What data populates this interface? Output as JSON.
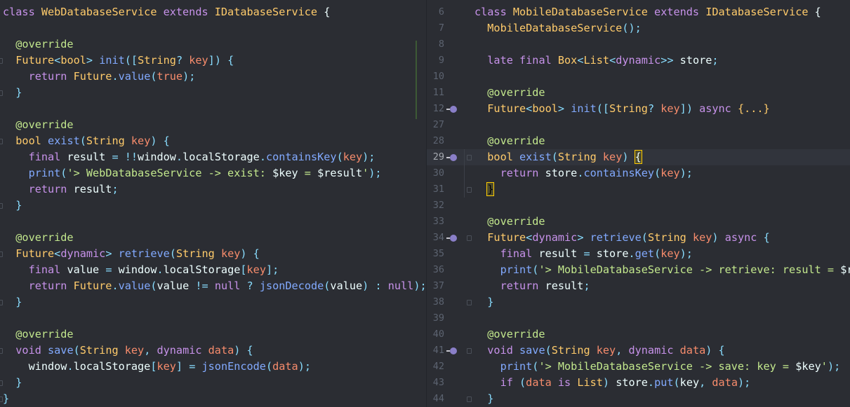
{
  "left_pane": {
    "lines": [
      {
        "segs": [
          [
            "class ",
            "kw"
          ],
          [
            "WebDatabaseService ",
            "tp"
          ],
          [
            "extends ",
            "kw"
          ],
          [
            "IDatabaseService ",
            "tp"
          ],
          [
            "{",
            "br"
          ]
        ]
      },
      {
        "segs": []
      },
      {
        "segs": [
          [
            "  @override",
            "ann"
          ]
        ]
      },
      {
        "segs": [
          [
            "  Future",
            "tp"
          ],
          [
            "<",
            "op"
          ],
          [
            "bool",
            "tp"
          ],
          [
            "> ",
            "op"
          ],
          [
            "init",
            "fn"
          ],
          [
            "([",
            "op"
          ],
          [
            "String",
            "tp"
          ],
          [
            "? ",
            "op"
          ],
          [
            "key",
            "par"
          ],
          [
            "]) {",
            "op"
          ]
        ]
      },
      {
        "segs": [
          [
            "    return ",
            "kw"
          ],
          [
            "Future",
            "tp"
          ],
          [
            ".",
            "op"
          ],
          [
            "value",
            "fn"
          ],
          [
            "(",
            "op"
          ],
          [
            "true",
            "num"
          ],
          [
            ");",
            "op"
          ]
        ]
      },
      {
        "segs": [
          [
            "  }",
            "op"
          ]
        ]
      },
      {
        "segs": []
      },
      {
        "segs": [
          [
            "  @override",
            "ann"
          ]
        ]
      },
      {
        "segs": [
          [
            "  bool ",
            "tp"
          ],
          [
            "exist",
            "fn"
          ],
          [
            "(",
            "op"
          ],
          [
            "String ",
            "tp"
          ],
          [
            "key",
            "par"
          ],
          [
            ") {",
            "op"
          ]
        ]
      },
      {
        "segs": [
          [
            "    final ",
            "kw"
          ],
          [
            "result ",
            "tx"
          ],
          [
            "= ",
            "op"
          ],
          [
            "!!",
            "op"
          ],
          [
            "window",
            "tx"
          ],
          [
            ".",
            "op"
          ],
          [
            "localStorage",
            "tx"
          ],
          [
            ".",
            "op"
          ],
          [
            "containsKey",
            "fn"
          ],
          [
            "(",
            "op"
          ],
          [
            "key",
            "par"
          ],
          [
            ");",
            "op"
          ]
        ]
      },
      {
        "segs": [
          [
            "    print",
            "fn"
          ],
          [
            "(",
            "op"
          ],
          [
            "'> WebDatabaseService -> exist: ",
            "str"
          ],
          [
            "$key",
            "tx"
          ],
          [
            " = ",
            "str"
          ],
          [
            "$result",
            "tx"
          ],
          [
            "'",
            "str"
          ],
          [
            ");",
            "op"
          ]
        ]
      },
      {
        "segs": [
          [
            "    return ",
            "kw"
          ],
          [
            "result",
            "tx"
          ],
          [
            ";",
            "op"
          ]
        ]
      },
      {
        "segs": [
          [
            "  }",
            "op"
          ]
        ]
      },
      {
        "segs": []
      },
      {
        "segs": [
          [
            "  @override",
            "ann"
          ]
        ]
      },
      {
        "segs": [
          [
            "  Future",
            "tp"
          ],
          [
            "<",
            "op"
          ],
          [
            "dynamic",
            "kw"
          ],
          [
            "> ",
            "op"
          ],
          [
            "retrieve",
            "fn"
          ],
          [
            "(",
            "op"
          ],
          [
            "String ",
            "tp"
          ],
          [
            "key",
            "par"
          ],
          [
            ") {",
            "op"
          ]
        ]
      },
      {
        "segs": [
          [
            "    final ",
            "kw"
          ],
          [
            "value ",
            "tx"
          ],
          [
            "= ",
            "op"
          ],
          [
            "window",
            "tx"
          ],
          [
            ".",
            "op"
          ],
          [
            "localStorage",
            "tx"
          ],
          [
            "[",
            "op"
          ],
          [
            "key",
            "par"
          ],
          [
            "];",
            "op"
          ]
        ]
      },
      {
        "segs": [
          [
            "    return ",
            "kw"
          ],
          [
            "Future",
            "tp"
          ],
          [
            ".",
            "op"
          ],
          [
            "value",
            "fn"
          ],
          [
            "(",
            "op"
          ],
          [
            "value ",
            "tx"
          ],
          [
            "!= ",
            "op"
          ],
          [
            "null ",
            "kw"
          ],
          [
            "? ",
            "op"
          ],
          [
            "jsonDecode",
            "fn"
          ],
          [
            "(",
            "op"
          ],
          [
            "value",
            "tx"
          ],
          [
            ") ",
            "op"
          ],
          [
            ": ",
            "op"
          ],
          [
            "null",
            "kw"
          ],
          [
            ");",
            "op"
          ]
        ]
      },
      {
        "segs": [
          [
            "  }",
            "op"
          ]
        ]
      },
      {
        "segs": []
      },
      {
        "segs": [
          [
            "  @override",
            "ann"
          ]
        ]
      },
      {
        "segs": [
          [
            "  void ",
            "kw"
          ],
          [
            "save",
            "fn"
          ],
          [
            "(",
            "op"
          ],
          [
            "String ",
            "tp"
          ],
          [
            "key",
            "par"
          ],
          [
            ", ",
            "op"
          ],
          [
            "dynamic ",
            "kw"
          ],
          [
            "data",
            "par"
          ],
          [
            ") {",
            "op"
          ]
        ]
      },
      {
        "segs": [
          [
            "    window",
            "tx"
          ],
          [
            ".",
            "op"
          ],
          [
            "localStorage",
            "tx"
          ],
          [
            "[",
            "op"
          ],
          [
            "key",
            "par"
          ],
          [
            "] ",
            "op"
          ],
          [
            "= ",
            "op"
          ],
          [
            "jsonEncode",
            "fn"
          ],
          [
            "(",
            "op"
          ],
          [
            "data",
            "par"
          ],
          [
            ");",
            "op"
          ]
        ]
      },
      {
        "segs": [
          [
            "  }",
            "op"
          ]
        ]
      },
      {
        "segs": [
          [
            "}",
            "op"
          ]
        ]
      }
    ]
  },
  "right_pane": {
    "lines": [
      {
        "num": "6",
        "segs": [
          [
            "class ",
            "kw"
          ],
          [
            "MobileDatabaseService ",
            "tp"
          ],
          [
            "extends ",
            "kw"
          ],
          [
            "IDatabaseService ",
            "tp"
          ],
          [
            "{",
            "br"
          ]
        ]
      },
      {
        "num": "7",
        "segs": [
          [
            "  MobileDatabaseService",
            "tp"
          ],
          [
            "();",
            "op"
          ]
        ]
      },
      {
        "num": "8",
        "segs": []
      },
      {
        "num": "9",
        "segs": [
          [
            "  late ",
            "kw"
          ],
          [
            "final ",
            "kw"
          ],
          [
            "Box",
            "tp"
          ],
          [
            "<",
            "op"
          ],
          [
            "List",
            "tp"
          ],
          [
            "<",
            "op"
          ],
          [
            "dynamic",
            "kw"
          ],
          [
            ">> ",
            "op"
          ],
          [
            "store",
            "tx"
          ],
          [
            ";",
            "op"
          ]
        ]
      },
      {
        "num": "10",
        "segs": []
      },
      {
        "num": "11",
        "segs": [
          [
            "  @override",
            "ann"
          ]
        ]
      },
      {
        "num": "12",
        "override": true,
        "segs": [
          [
            "  Future",
            "tp"
          ],
          [
            "<",
            "op"
          ],
          [
            "bool",
            "tp"
          ],
          [
            "> ",
            "op"
          ],
          [
            "init",
            "fn"
          ],
          [
            "([",
            "op"
          ],
          [
            "String",
            "tp"
          ],
          [
            "? ",
            "op"
          ],
          [
            "key",
            "par"
          ],
          [
            "]) ",
            "op"
          ],
          [
            "async ",
            "kw"
          ],
          [
            "{...}",
            "tp"
          ]
        ]
      },
      {
        "num": "27",
        "segs": []
      },
      {
        "num": "28",
        "segs": [
          [
            "  @override",
            "ann"
          ]
        ]
      },
      {
        "num": "29",
        "override": true,
        "current": true,
        "segs": [
          [
            "  bool ",
            "tp"
          ],
          [
            "exist",
            "fn"
          ],
          [
            "(",
            "op"
          ],
          [
            "String ",
            "tp"
          ],
          [
            "key",
            "par"
          ],
          [
            ") ",
            "op"
          ],
          [
            "{",
            "caretbr"
          ]
        ]
      },
      {
        "num": "30",
        "segs": [
          [
            "    return ",
            "kw"
          ],
          [
            "store",
            "tx"
          ],
          [
            ".",
            "op"
          ],
          [
            "containsKey",
            "fn"
          ],
          [
            "(",
            "op"
          ],
          [
            "key",
            "par"
          ],
          [
            ");",
            "op"
          ]
        ]
      },
      {
        "num": "31",
        "segs": [
          [
            "  ",
            "tx"
          ],
          [
            "}",
            "hlbr"
          ]
        ]
      },
      {
        "num": "32",
        "segs": []
      },
      {
        "num": "33",
        "segs": [
          [
            "  @override",
            "ann"
          ]
        ]
      },
      {
        "num": "34",
        "override": true,
        "segs": [
          [
            "  Future",
            "tp"
          ],
          [
            "<",
            "op"
          ],
          [
            "dynamic",
            "kw"
          ],
          [
            "> ",
            "op"
          ],
          [
            "retrieve",
            "fn"
          ],
          [
            "(",
            "op"
          ],
          [
            "String ",
            "tp"
          ],
          [
            "key",
            "par"
          ],
          [
            ") ",
            "op"
          ],
          [
            "async ",
            "kw"
          ],
          [
            "{",
            "op"
          ]
        ]
      },
      {
        "num": "35",
        "segs": [
          [
            "    final ",
            "kw"
          ],
          [
            "result ",
            "tx"
          ],
          [
            "= ",
            "op"
          ],
          [
            "store",
            "tx"
          ],
          [
            ".",
            "op"
          ],
          [
            "get",
            "fn"
          ],
          [
            "(",
            "op"
          ],
          [
            "key",
            "par"
          ],
          [
            ");",
            "op"
          ]
        ]
      },
      {
        "num": "36",
        "segs": [
          [
            "    print",
            "fn"
          ],
          [
            "(",
            "op"
          ],
          [
            "'> MobileDatabaseService -> retrieve: result = ",
            "str"
          ],
          [
            "$re",
            "tx"
          ]
        ]
      },
      {
        "num": "37",
        "segs": [
          [
            "    return ",
            "kw"
          ],
          [
            "result",
            "tx"
          ],
          [
            ";",
            "op"
          ]
        ]
      },
      {
        "num": "38",
        "segs": [
          [
            "  }",
            "op"
          ]
        ]
      },
      {
        "num": "39",
        "segs": []
      },
      {
        "num": "40",
        "segs": [
          [
            "  @override",
            "ann"
          ]
        ]
      },
      {
        "num": "41",
        "override": true,
        "segs": [
          [
            "  void ",
            "kw"
          ],
          [
            "save",
            "fn"
          ],
          [
            "(",
            "op"
          ],
          [
            "String ",
            "tp"
          ],
          [
            "key",
            "par"
          ],
          [
            ", ",
            "op"
          ],
          [
            "dynamic ",
            "kw"
          ],
          [
            "data",
            "par"
          ],
          [
            ") {",
            "op"
          ]
        ]
      },
      {
        "num": "42",
        "segs": [
          [
            "    print",
            "fn"
          ],
          [
            "(",
            "op"
          ],
          [
            "'> MobileDatabaseService -> save: key = ",
            "str"
          ],
          [
            "$key",
            "tx"
          ],
          [
            "'",
            "str"
          ],
          [
            ");",
            "op"
          ]
        ]
      },
      {
        "num": "43",
        "segs": [
          [
            "    if ",
            "kw"
          ],
          [
            "(",
            "op"
          ],
          [
            "data ",
            "par"
          ],
          [
            "is ",
            "kw"
          ],
          [
            "List",
            "tp"
          ],
          [
            ") ",
            "op"
          ],
          [
            "store",
            "tx"
          ],
          [
            ".",
            "op"
          ],
          [
            "put",
            "fn"
          ],
          [
            "(",
            "op"
          ],
          [
            "key",
            "tx"
          ],
          [
            ", ",
            "op"
          ],
          [
            "data",
            "par"
          ],
          [
            ");",
            "op"
          ]
        ]
      },
      {
        "num": "44",
        "segs": [
          [
            "  }",
            "op"
          ]
        ]
      }
    ]
  }
}
